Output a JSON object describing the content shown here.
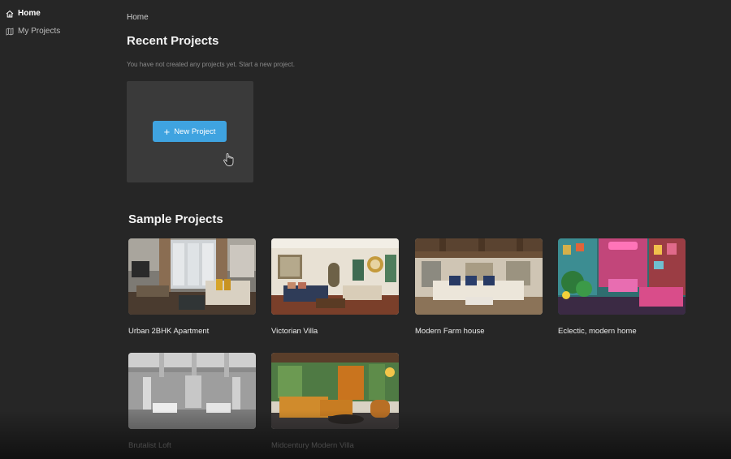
{
  "sidebar": {
    "items": [
      {
        "label": "Home",
        "icon": "home-icon"
      },
      {
        "label": "My Projects",
        "icon": "map-icon"
      }
    ]
  },
  "main": {
    "breadcrumb": "Home",
    "recent_title": "Recent Projects",
    "empty_message": "You have not created any projects yet. Start a new project.",
    "new_project_label": "New Project",
    "sample_title": "Sample Projects",
    "samples": [
      {
        "title": "Urban 2BHK Apartment"
      },
      {
        "title": "Victorian Villa"
      },
      {
        "title": "Modern Farm house"
      },
      {
        "title": "Eclectic, modern home"
      },
      {
        "title": "Brutalist Loft"
      },
      {
        "title": "Midcentury Modern Villa"
      }
    ]
  },
  "colors": {
    "background": "#262626",
    "card": "#3a3a3a",
    "accent": "#3fa3e0"
  }
}
